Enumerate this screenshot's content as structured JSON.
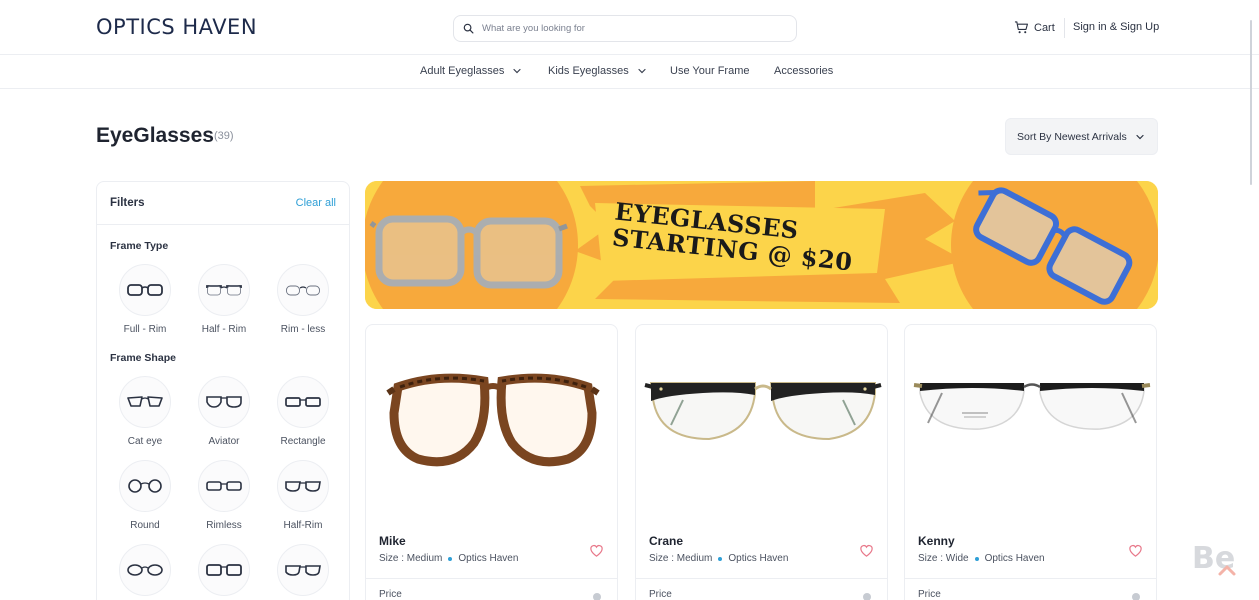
{
  "header": {
    "logo": "OPTICS HAVEN",
    "search_placeholder": "What are you looking for",
    "cart_label": "Cart",
    "signin_label": "Sign in & Sign Up"
  },
  "nav": {
    "items": [
      {
        "label": "Adult Eyeglasses",
        "has_dropdown": true
      },
      {
        "label": "Kids Eyeglasses",
        "has_dropdown": true
      },
      {
        "label": "Use Your Frame",
        "has_dropdown": false
      },
      {
        "label": "Accessories",
        "has_dropdown": false
      }
    ]
  },
  "page": {
    "title": "EyeGlasses",
    "count": "(39)",
    "sort_label": "Sort By Newest Arrivals"
  },
  "filters": {
    "title": "Filters",
    "clear_label": "Clear all",
    "frame_type": {
      "title": "Frame Type",
      "options": [
        "Full - Rim",
        "Half - Rim",
        "Rim - less"
      ]
    },
    "frame_shape": {
      "title": "Frame Shape",
      "options": [
        "Cat eye",
        "Aviator",
        "Rectangle",
        "Round",
        "Rimless",
        "Half-Rim"
      ]
    }
  },
  "banner": {
    "line1": "EYEGLASSES",
    "line2": "STARTING @ $20"
  },
  "products": [
    {
      "name": "Mike",
      "size": "Size : Medium",
      "brand": "Optics Haven",
      "price_label": "Price"
    },
    {
      "name": "Crane",
      "size": "Size : Medium",
      "brand": "Optics Haven",
      "price_label": "Price"
    },
    {
      "name": "Kenny",
      "size": "Size : Wide",
      "brand": "Optics Haven",
      "price_label": "Price"
    }
  ],
  "colors": {
    "accent": "#2f9fd6",
    "banner_yellow": "#fcd44a",
    "banner_orange": "#f7a93c",
    "heart": "#e8788a"
  },
  "watermark": "Be"
}
